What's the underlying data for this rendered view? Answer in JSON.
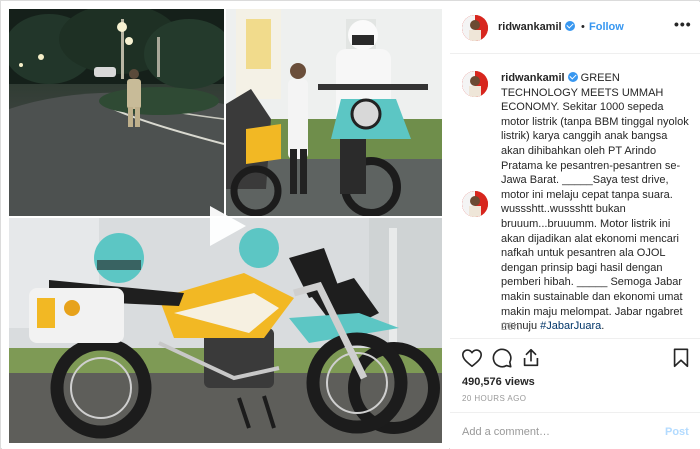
{
  "post": {
    "username": "ridwankamil",
    "verified": true,
    "separator": "•",
    "follow_label": "Follow",
    "more_label": "•••",
    "caption_title": "GREEN TECHNOLOGY MEETS UMMAH ECONOMY.",
    "caption_body": "Sekitar 1000 sepeda motor listrik (tanpa BBM tinggal nyolok listrik) karya canggih anak bangsa akan dihibahkan oleh PT Arindo Pratama ke pesantren-pesantren se-Jawa Barat. _____Saya test drive, motor ini melaju cepat tanpa suara. wussshtt..wussshtt bukan bruuum...bruuumm. Motor listrik ini akan dijadikan alat ekonomi mencari nafkah untuk pesantren ala OJOL dengan prinsip bagi hasil dengan pemberi hibah. _____ Semoga Jabar makin sustainable dan ekonomi umat makin maju melompat. Jabar ngabret menuju",
    "hashtag": "#JabarJuara",
    "caption_end": ".",
    "time_ago": "20h",
    "views": "490,576 views",
    "posted": "20 HOURS AGO"
  },
  "comment": {
    "placeholder": "Add a comment…",
    "post_label": "Post"
  },
  "icons": {
    "like": "heart-icon",
    "comment": "comment-icon",
    "share": "share-icon",
    "save": "bookmark-icon",
    "play": "play-icon"
  },
  "colors": {
    "link": "#3897f0",
    "hashtag": "#003569",
    "muted": "#999999",
    "post_disabled": "#b3dbff",
    "bike_yellow": "#f2b824",
    "bike_teal": "#5cc6c4"
  }
}
